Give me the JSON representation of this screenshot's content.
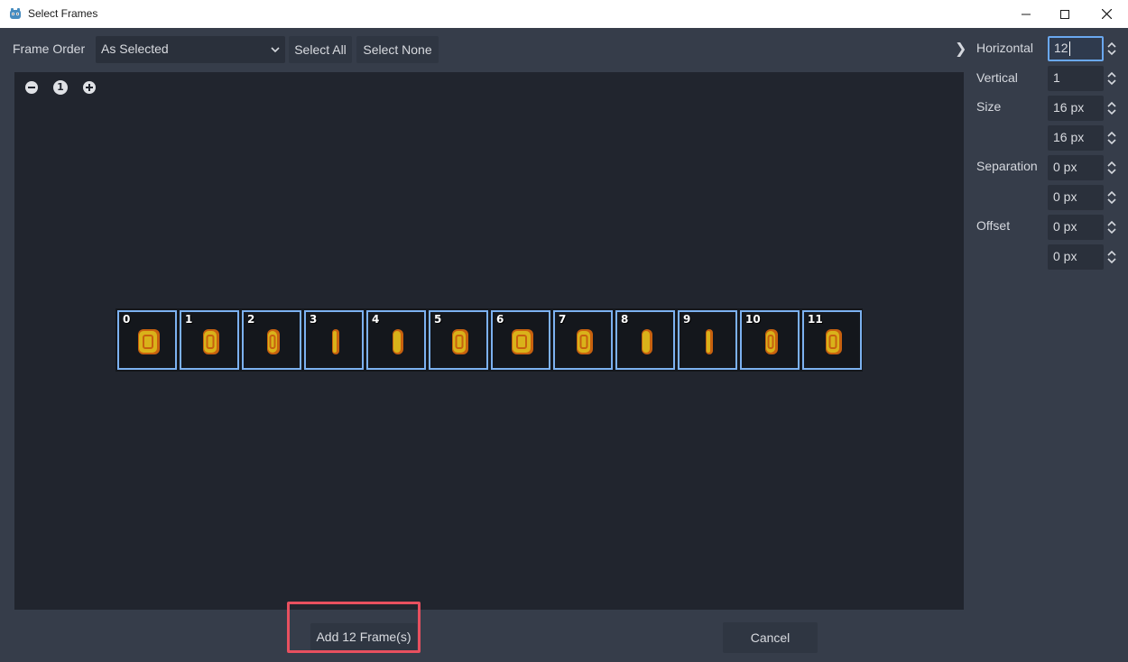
{
  "window": {
    "title": "Select Frames"
  },
  "toolbar": {
    "frame_order_label": "Frame Order",
    "frame_order_value": "As Selected",
    "select_all": "Select All",
    "select_none": "Select None"
  },
  "zoom": {
    "reset_label": "1"
  },
  "frames": [
    "0",
    "1",
    "2",
    "3",
    "4",
    "5",
    "6",
    "7",
    "8",
    "9",
    "10",
    "11"
  ],
  "side": {
    "toggle": "❯",
    "horizontal_label": "Horizontal",
    "horizontal_value": "12",
    "vertical_label": "Vertical",
    "vertical_value": "1",
    "size_label": "Size",
    "size_x": "16 px",
    "size_y": "16 px",
    "separation_label": "Separation",
    "separation_x": "0 px",
    "separation_y": "0 px",
    "offset_label": "Offset",
    "offset_x": "0 px",
    "offset_y": "0 px"
  },
  "footer": {
    "add_label": "Add 12 Frame(s)",
    "cancel_label": "Cancel"
  },
  "colors": {
    "accent": "#7cb1f0",
    "highlight": "#e8505f",
    "coin_gold": "#d9b21a",
    "coin_orange": "#c8610e"
  },
  "icons": [
    "godot-icon",
    "minimize-icon",
    "maximize-icon",
    "close-icon",
    "chevron-down-icon",
    "zoom-out-icon",
    "zoom-in-icon",
    "spin-arrows-icon"
  ]
}
